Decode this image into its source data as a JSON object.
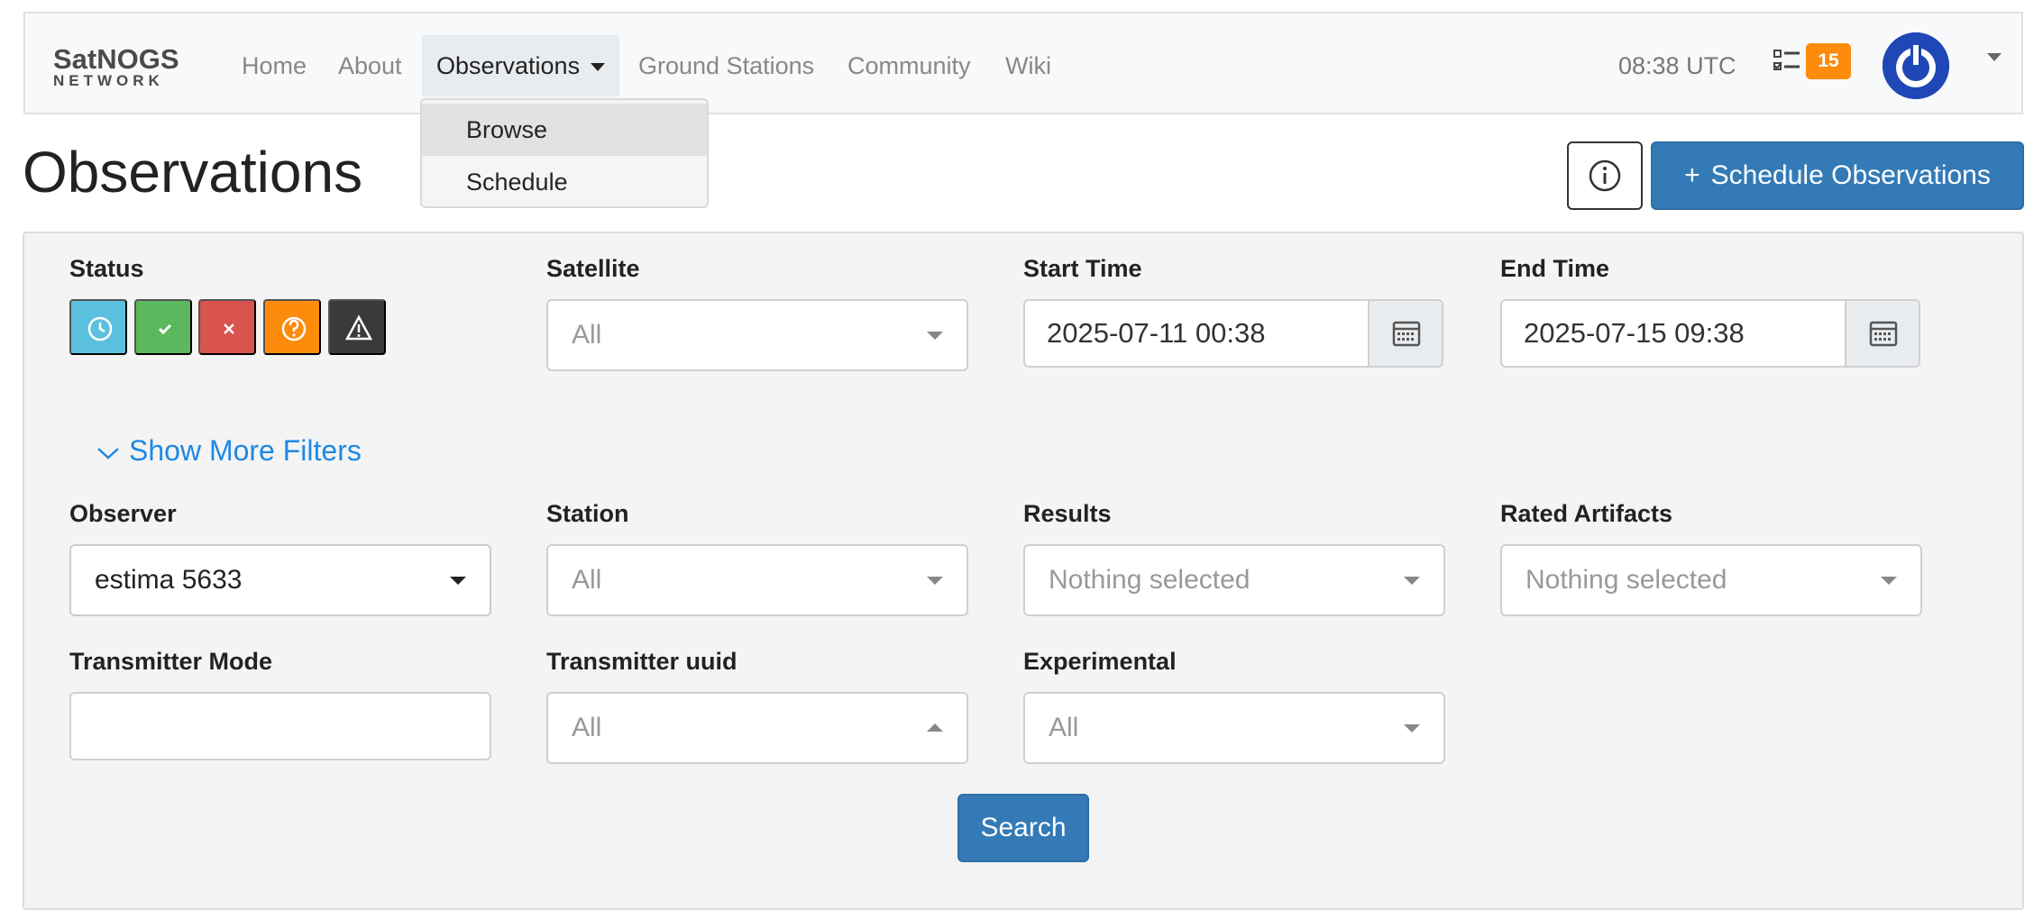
{
  "navbar": {
    "brand_top": "SatNOGS",
    "brand_bottom": "NETWORK",
    "links": [
      {
        "label": "Home"
      },
      {
        "label": "About"
      },
      {
        "label": "Observations"
      },
      {
        "label": "Ground Stations"
      },
      {
        "label": "Community"
      },
      {
        "label": "Wiki"
      }
    ],
    "clock": "08:38 UTC",
    "task_count": "15",
    "badge_color": "#fd8b0c",
    "avatar_color": "#1f47b5"
  },
  "dropdown": {
    "items": [
      {
        "label": "Browse"
      },
      {
        "label": "Schedule"
      }
    ]
  },
  "page": {
    "title": "Observations",
    "schedule_button": "Schedule Observations",
    "accent": "#337ab7"
  },
  "filters": {
    "status_label": "Status",
    "status_buttons": [
      {
        "icon": "clock-icon",
        "color": "#5bc0de"
      },
      {
        "icon": "check-icon",
        "color": "#5cb85c"
      },
      {
        "icon": "x-icon",
        "color": "#d9534f"
      },
      {
        "icon": "question-icon",
        "color": "#fd8b0c"
      },
      {
        "icon": "warning-icon",
        "color": "#3a3a3a"
      }
    ],
    "satellite": {
      "label": "Satellite",
      "value": "All"
    },
    "start_time": {
      "label": "Start Time",
      "value": "2025-07-11 00:38"
    },
    "end_time": {
      "label": "End Time",
      "value": "2025-07-15 09:38"
    },
    "show_more": "Show More Filters",
    "observer": {
      "label": "Observer",
      "value": "estima 5633"
    },
    "station": {
      "label": "Station",
      "value": "All"
    },
    "results": {
      "label": "Results",
      "value": "Nothing selected"
    },
    "rated_artifacts": {
      "label": "Rated Artifacts",
      "value": "Nothing selected"
    },
    "transmitter_mode": {
      "label": "Transmitter Mode",
      "value": ""
    },
    "transmitter_uuid": {
      "label": "Transmitter uuid",
      "value": "All"
    },
    "experimental": {
      "label": "Experimental",
      "value": "All"
    },
    "search_button": "Search"
  }
}
